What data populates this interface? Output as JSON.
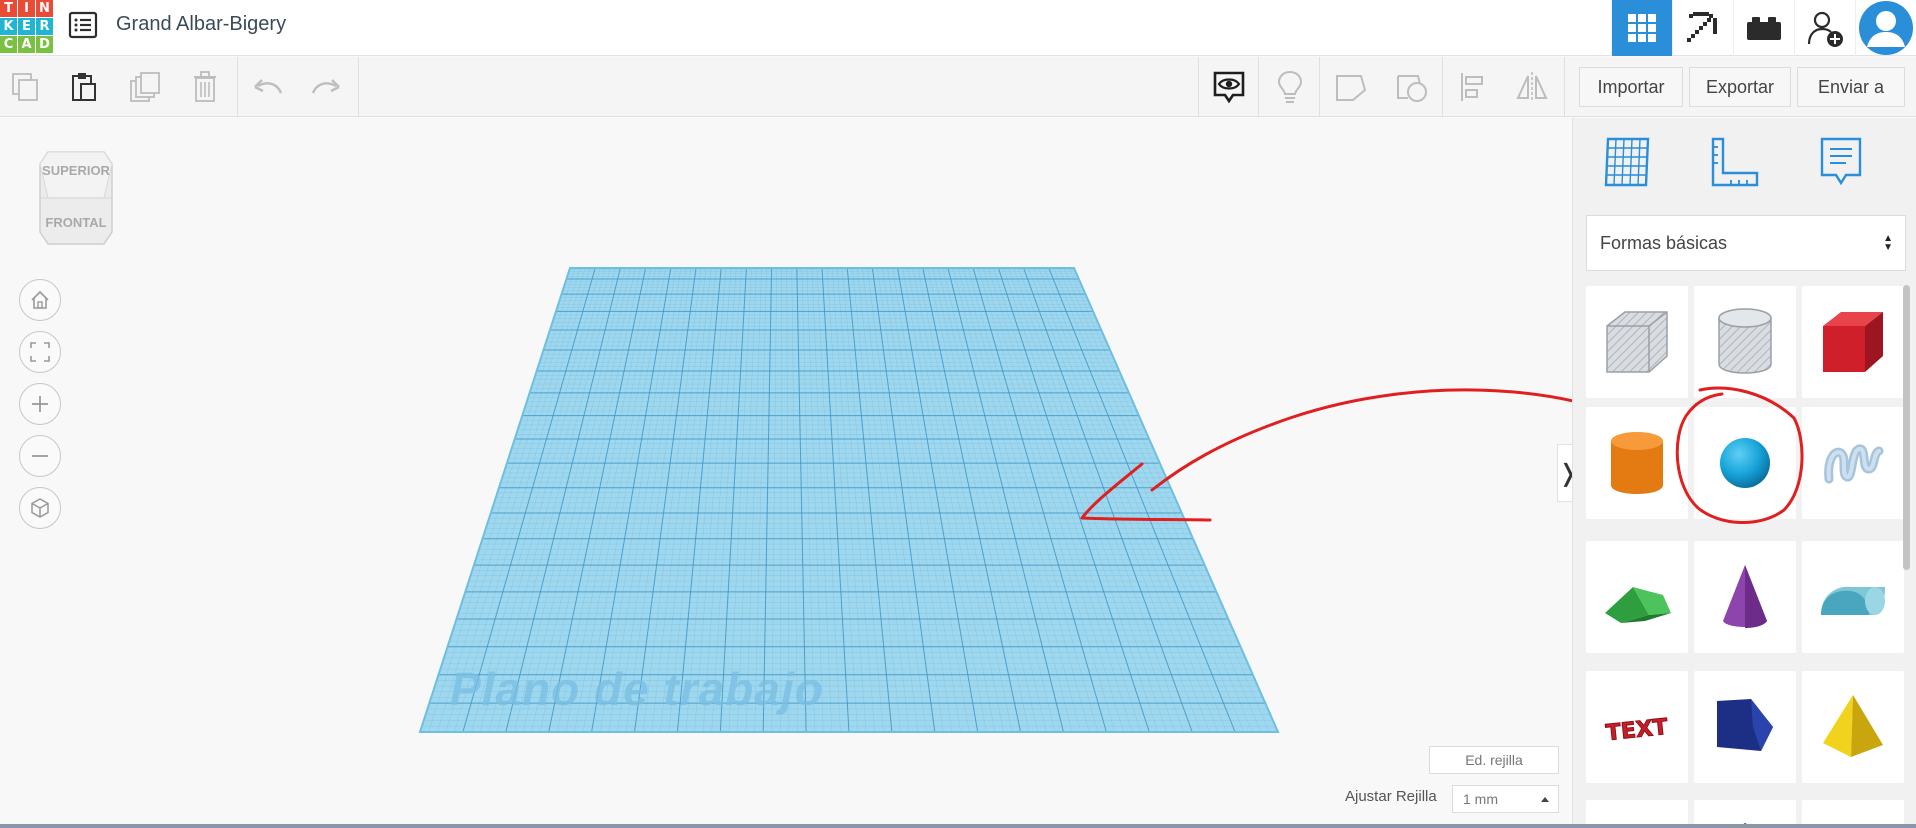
{
  "app": {
    "logo_letters": [
      "T",
      "I",
      "N",
      "K",
      "E",
      "R",
      "C",
      "A",
      "D"
    ],
    "logo_colors": [
      "#e94b35",
      "#e94b35",
      "#e94b35",
      "#1fb5d3",
      "#1fb5d3",
      "#1fb5d3",
      "#7ac043",
      "#7ac043",
      "#7ac043"
    ],
    "design_title": "Grand Albar-Bigery",
    "accent": "#2a8ed8"
  },
  "header": {
    "icons": [
      "grid-view-icon",
      "pickaxe-icon",
      "bricks-icon",
      "invite-user-icon",
      "user-avatar-icon"
    ]
  },
  "toolbar": {
    "import_label": "Importar",
    "export_label": "Exportar",
    "send_label": "Enviar a"
  },
  "viewport": {
    "viewcube_top": "SUPERIOR",
    "viewcube_front": "FRONTAL",
    "workplane_label": "Plano de trabajo",
    "grid_edit_label": "Ed. rejilla",
    "snap_label": "Ajustar Rejilla",
    "snap_value": "1 mm",
    "collapse_glyph": "❭"
  },
  "panel": {
    "category": "Formas básicas",
    "shapes": [
      "box-hole",
      "cylinder-hole",
      "box",
      "cylinder",
      "sphere",
      "scribble",
      "roof",
      "cone",
      "round-roof",
      "text",
      "wedge",
      "pyramid"
    ]
  }
}
